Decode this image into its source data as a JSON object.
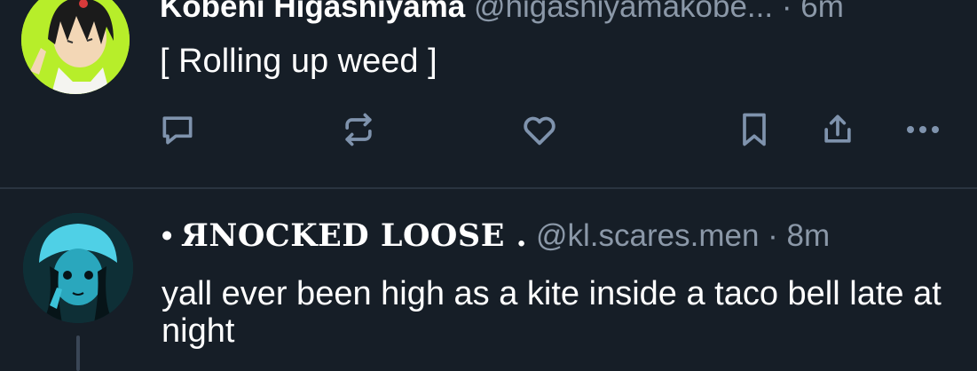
{
  "posts": [
    {
      "author": {
        "display_name": "Kobeni Higashiyama",
        "handle": "@higashiyamakobe...",
        "time": "· 6m"
      },
      "text": "[ Rolling up weed ]"
    },
    {
      "author": {
        "prefix": "•",
        "display_name": "ЯNOCKED LOOSE .",
        "handle": "@kl.scares.men",
        "time": "· 8m"
      },
      "text": "yall ever been high as a kite inside a taco bell late at night"
    }
  ],
  "actions": [
    "reply-icon",
    "repost-icon",
    "like-icon",
    "bookmark-icon",
    "share-icon",
    "more-icon"
  ],
  "colors": {
    "background": "#161e27",
    "muted": "#8b98a8",
    "icon": "#7f93ad",
    "divider": "#2a3440"
  }
}
